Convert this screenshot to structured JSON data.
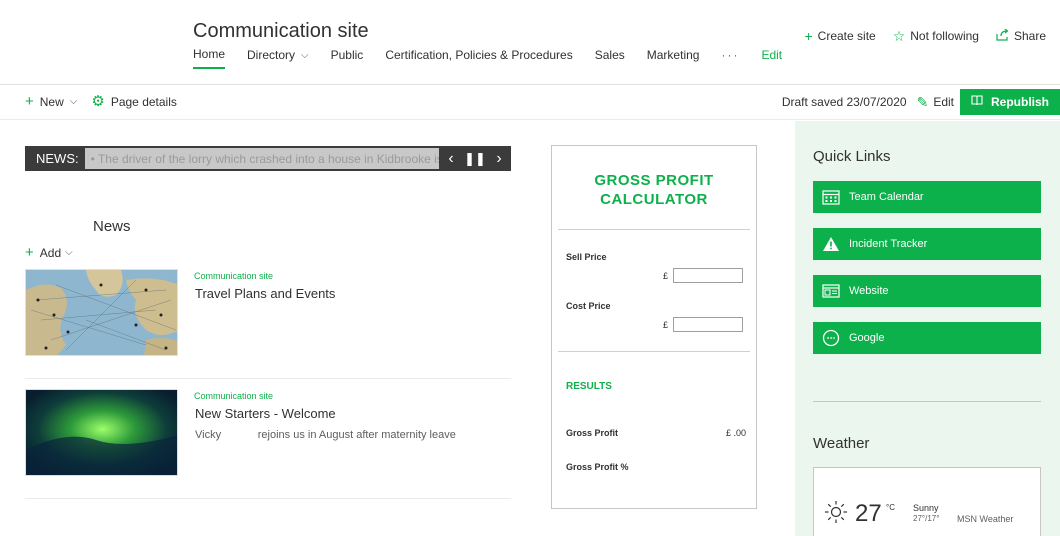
{
  "header": {
    "site_title": "Communication site",
    "nav": [
      {
        "label": "Home"
      },
      {
        "label": "Directory"
      },
      {
        "label": "Public"
      },
      {
        "label": "Certification, Policies & Procedures"
      },
      {
        "label": "Sales"
      },
      {
        "label": "Marketing"
      },
      {
        "label": "···"
      },
      {
        "label": "Edit"
      }
    ],
    "actions": {
      "create_site": "Create site",
      "not_following": "Not following",
      "share": "Share"
    }
  },
  "command_bar": {
    "new_label": "New",
    "page_details_label": "Page details",
    "draft_status": "Draft saved 23/07/2020",
    "edit_label": "Edit",
    "republish_label": "Republish"
  },
  "ticker": {
    "label": "NEWS:",
    "text": "• The driver of the lorry which crashed into a house in Kidbrooke is"
  },
  "news": {
    "title": "News",
    "add_label": "Add",
    "items": [
      {
        "source": "Communication site",
        "title": "Travel Plans and Events",
        "description": ""
      },
      {
        "source": "Communication site",
        "title": "New Starters - Welcome",
        "description": "Vicky            rejoins us in August after maternity leave"
      }
    ]
  },
  "calculator": {
    "title_line1": "GROSS PROFIT",
    "title_line2": "CALCULATOR",
    "sell_price_label": "Sell Price",
    "cost_price_label": "Cost Price",
    "currency": "£",
    "sell_price_value": "",
    "cost_price_value": "",
    "results_label": "RESULTS",
    "gross_profit_label": "Gross Profit",
    "gross_profit_value": "£ .00",
    "gross_profit_pct_label": "Gross Profit %",
    "gross_profit_pct_value": ""
  },
  "quick_links": {
    "title": "Quick Links",
    "items": [
      {
        "label": "Team Calendar",
        "icon": "calendar-icon"
      },
      {
        "label": "Incident Tracker",
        "icon": "warning-icon"
      },
      {
        "label": "Website",
        "icon": "website-icon"
      },
      {
        "label": "Google",
        "icon": "link-icon"
      }
    ]
  },
  "weather": {
    "title": "Weather",
    "temperature": "27",
    "unit": "°C",
    "condition": "Sunny",
    "range": "27°/17°",
    "source": "MSN Weather"
  },
  "colors": {
    "accent": "#0db14b",
    "panel_bg": "#eaf6ee",
    "ticker_bg": "#3b3b3b"
  }
}
